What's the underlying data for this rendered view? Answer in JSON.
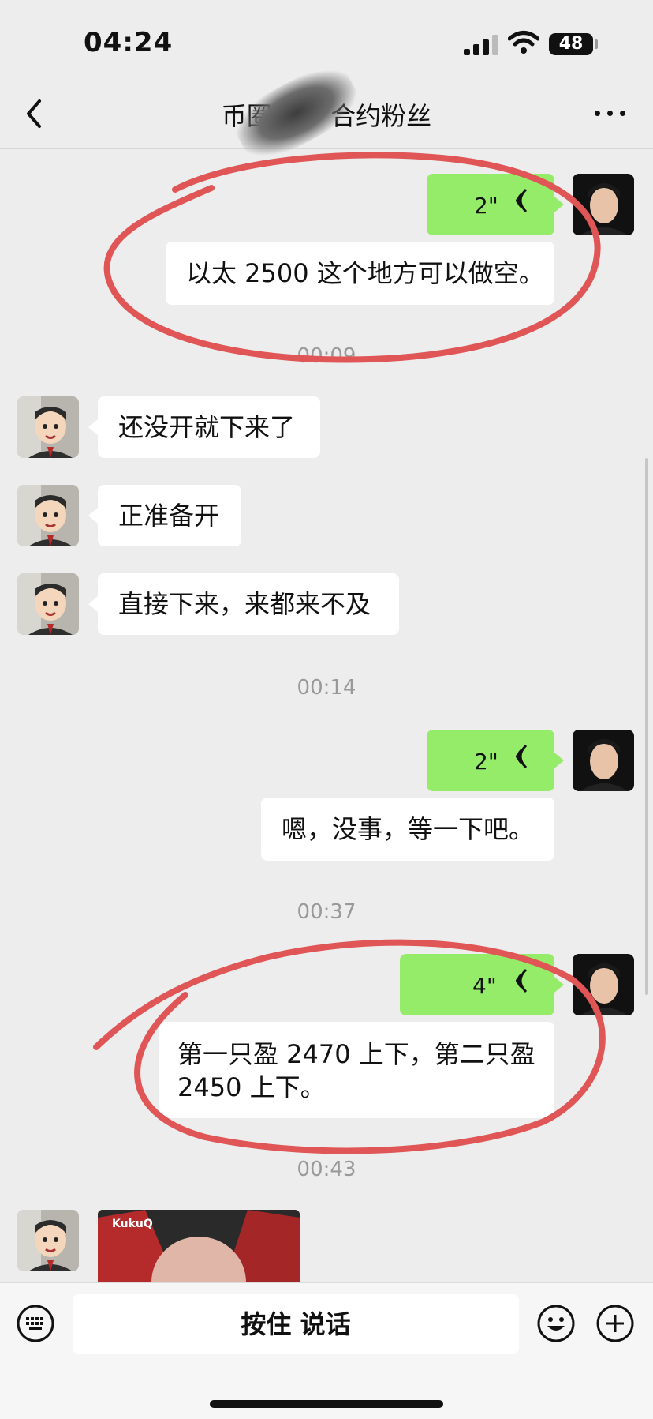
{
  "status_bar": {
    "time": "04:24",
    "battery": "48"
  },
  "nav": {
    "title": "币圈～           、合约粉丝",
    "back_icon": "chevron-left-icon",
    "more_icon": "more-dots-icon"
  },
  "messages": [
    {
      "side": "right",
      "type": "voice",
      "duration": "2\""
    },
    {
      "side": "right",
      "type": "text",
      "text": "以太 2500 这个地方可以做空。"
    },
    {
      "type": "time",
      "text": "00:09"
    },
    {
      "side": "left",
      "type": "text",
      "text": "还没开就下来了"
    },
    {
      "side": "left",
      "type": "text",
      "text": "正准备开"
    },
    {
      "side": "left",
      "type": "text",
      "text": "直接下来，来都来不及"
    },
    {
      "type": "time",
      "text": "00:14"
    },
    {
      "side": "right",
      "type": "voice",
      "duration": "2\""
    },
    {
      "side": "right",
      "type": "text",
      "text": "嗯，没事，等一下吧。"
    },
    {
      "type": "time",
      "text": "00:37"
    },
    {
      "side": "right",
      "type": "voice",
      "duration": "4\""
    },
    {
      "side": "right",
      "type": "text",
      "text_line1": "第一只盈 2470 上下，第二只盈",
      "text_line2": "2450 上下。"
    },
    {
      "type": "time",
      "text": "00:43"
    },
    {
      "side": "left",
      "type": "image",
      "label": "KukuQ"
    }
  ],
  "input_bar": {
    "talk_label": "按住 说话",
    "keyboard_icon": "keyboard-icon",
    "emoji_icon": "emoji-icon",
    "plus_icon": "plus-icon"
  },
  "colors": {
    "background": "#ededed",
    "bubble_green": "#95ec69",
    "bubble_white": "#ffffff",
    "annotation": "#e05555"
  }
}
